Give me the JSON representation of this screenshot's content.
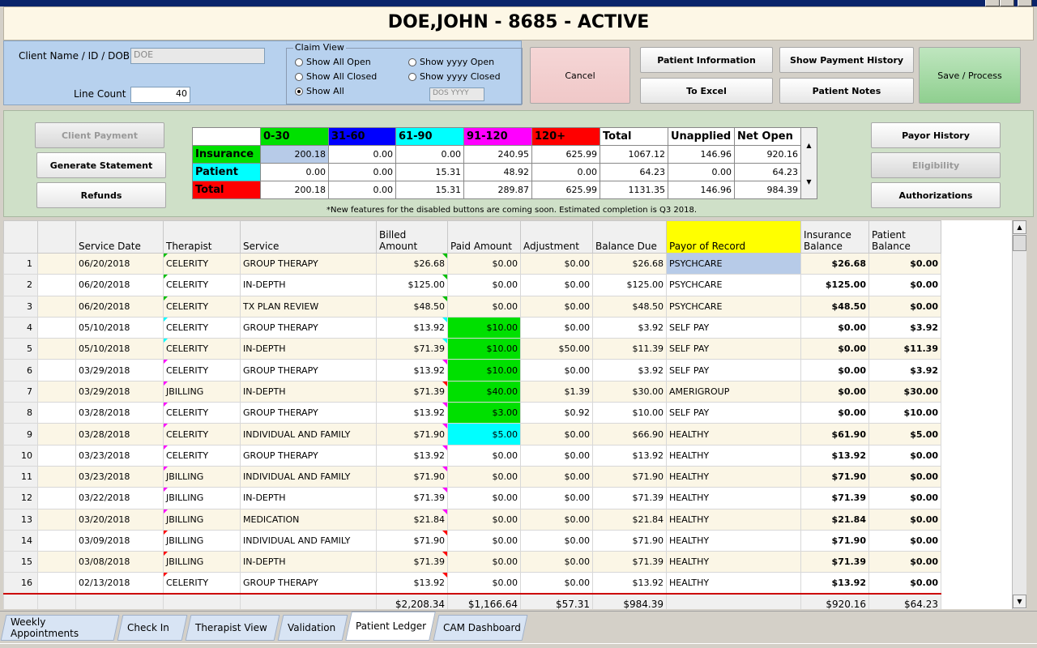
{
  "header": {
    "title": "DOE,JOHN - 8685 - ACTIVE"
  },
  "client": {
    "name_label": "Client Name / ID / DOB",
    "name_value": "DOE",
    "line_count_label": "Line Count",
    "line_count_value": "40"
  },
  "claim_view": {
    "legend": "Claim View",
    "options": [
      "Show All Open",
      "Show All Closed",
      "Show All",
      "Show yyyy Open",
      "Show yyyy Closed"
    ],
    "selected": "Show All",
    "dos_placeholder": "DOS YYYY"
  },
  "buttons": {
    "cancel": "Cancel",
    "patient_information": "Patient Information",
    "show_payment_history": "Show Payment History",
    "to_excel": "To Excel",
    "patient_notes": "Patient Notes",
    "save_process": "Save / Process",
    "client_payment": "Client Payment",
    "generate_statement": "Generate Statement",
    "refunds": "Refunds",
    "payor_history": "Payor History",
    "eligibility": "Eligibility",
    "authorizations": "Authorizations"
  },
  "aging": {
    "headers": [
      "0-30",
      "31-60",
      "61-90",
      "91-120",
      "120+",
      "Total",
      "Unapplied",
      "Net Open"
    ],
    "header_colors": [
      "#00e000",
      "#0000ff",
      "#00ffff",
      "#ff00ff",
      "#ff0000",
      "#ffffff",
      "#ffffff",
      "#ffffff"
    ],
    "rows": [
      {
        "label": "Insurance",
        "color": "#00e000",
        "values": [
          "200.18",
          "0.00",
          "0.00",
          "240.95",
          "625.99",
          "1067.12",
          "146.96",
          "920.16"
        ]
      },
      {
        "label": "Patient",
        "color": "#00ffff",
        "values": [
          "0.00",
          "0.00",
          "15.31",
          "48.92",
          "0.00",
          "64.23",
          "0.00",
          "64.23"
        ]
      },
      {
        "label": "Total",
        "color": "#ff0000",
        "values": [
          "200.18",
          "0.00",
          "15.31",
          "289.87",
          "625.99",
          "1131.35",
          "146.96",
          "984.39"
        ]
      }
    ],
    "note": "*New features for the disabled buttons are coming soon. Estimated completion is Q3 2018."
  },
  "grid": {
    "columns": [
      "",
      "",
      "Service Date",
      "Therapist",
      "Service",
      "Billed Amount",
      "Paid Amount",
      "Adjustment",
      "Balance Due",
      "Payor of Record",
      "Insurance Balance",
      "Patient Balance"
    ],
    "rows": [
      {
        "n": "1",
        "date": "06/20/2018",
        "therapist": "CELERITY",
        "service": "GROUP THERAPY",
        "billed": "$26.68",
        "paid": "$0.00",
        "adj": "$0.00",
        "due": "$26.68",
        "payor": "PSYCHCARE",
        "ins": "$26.68",
        "pat": "$0.00",
        "paid_color": "",
        "tflag": "#00c000",
        "bflag": "#00c000"
      },
      {
        "n": "2",
        "date": "06/20/2018",
        "therapist": "CELERITY",
        "service": "IN-DEPTH",
        "billed": "$125.00",
        "paid": "$0.00",
        "adj": "$0.00",
        "due": "$125.00",
        "payor": "PSYCHCARE",
        "ins": "$125.00",
        "pat": "$0.00",
        "paid_color": "",
        "tflag": "#00c000",
        "bflag": "#00c000"
      },
      {
        "n": "3",
        "date": "06/20/2018",
        "therapist": "CELERITY",
        "service": "TX PLAN REVIEW",
        "billed": "$48.50",
        "paid": "$0.00",
        "adj": "$0.00",
        "due": "$48.50",
        "payor": "PSYCHCARE",
        "ins": "$48.50",
        "pat": "$0.00",
        "paid_color": "",
        "tflag": "#00c000",
        "bflag": "#00c000"
      },
      {
        "n": "4",
        "date": "05/10/2018",
        "therapist": "CELERITY",
        "service": "GROUP THERAPY",
        "billed": "$13.92",
        "paid": "$10.00",
        "adj": "$0.00",
        "due": "$3.92",
        "payor": "SELF PAY",
        "ins": "$0.00",
        "pat": "$3.92",
        "paid_color": "#00e000",
        "tflag": "#00ffff",
        "bflag": "#00ffff"
      },
      {
        "n": "5",
        "date": "05/10/2018",
        "therapist": "CELERITY",
        "service": "IN-DEPTH",
        "billed": "$71.39",
        "paid": "$10.00",
        "adj": "$50.00",
        "due": "$11.39",
        "payor": "SELF PAY",
        "ins": "$0.00",
        "pat": "$11.39",
        "paid_color": "#00e000",
        "tflag": "#00ffff",
        "bflag": "#00ffff"
      },
      {
        "n": "6",
        "date": "03/29/2018",
        "therapist": "CELERITY",
        "service": "GROUP THERAPY",
        "billed": "$13.92",
        "paid": "$10.00",
        "adj": "$0.00",
        "due": "$3.92",
        "payor": "SELF PAY",
        "ins": "$0.00",
        "pat": "$3.92",
        "paid_color": "#00e000",
        "tflag": "#ff00ff",
        "bflag": "#ff00ff"
      },
      {
        "n": "7",
        "date": "03/29/2018",
        "therapist": "JBILLING",
        "service": "IN-DEPTH",
        "billed": "$71.39",
        "paid": "$40.00",
        "adj": "$1.39",
        "due": "$30.00",
        "payor": "AMERIGROUP",
        "ins": "$0.00",
        "pat": "$30.00",
        "paid_color": "#00e000",
        "tflag": "#ff00ff",
        "bflag": "#ff0000"
      },
      {
        "n": "8",
        "date": "03/28/2018",
        "therapist": "CELERITY",
        "service": "GROUP THERAPY",
        "billed": "$13.92",
        "paid": "$3.00",
        "adj": "$0.92",
        "due": "$10.00",
        "payor": "SELF PAY",
        "ins": "$0.00",
        "pat": "$10.00",
        "paid_color": "#00e000",
        "tflag": "#ff00ff",
        "bflag": "#ff00ff"
      },
      {
        "n": "9",
        "date": "03/28/2018",
        "therapist": "CELERITY",
        "service": "INDIVIDUAL AND FAMILY",
        "billed": "$71.90",
        "paid": "$5.00",
        "adj": "$0.00",
        "due": "$66.90",
        "payor": "HEALTHY",
        "ins": "$61.90",
        "pat": "$5.00",
        "paid_color": "#00ffff",
        "tflag": "#ff00ff",
        "bflag": "#ff00ff"
      },
      {
        "n": "10",
        "date": "03/23/2018",
        "therapist": "CELERITY",
        "service": "GROUP THERAPY",
        "billed": "$13.92",
        "paid": "$0.00",
        "adj": "$0.00",
        "due": "$13.92",
        "payor": "HEALTHY",
        "ins": "$13.92",
        "pat": "$0.00",
        "paid_color": "",
        "tflag": "#ff00ff",
        "bflag": "#ff00ff"
      },
      {
        "n": "11",
        "date": "03/23/2018",
        "therapist": "JBILLING",
        "service": "INDIVIDUAL AND FAMILY",
        "billed": "$71.90",
        "paid": "$0.00",
        "adj": "$0.00",
        "due": "$71.90",
        "payor": "HEALTHY",
        "ins": "$71.90",
        "pat": "$0.00",
        "paid_color": "",
        "tflag": "#ff00ff",
        "bflag": "#ff00ff"
      },
      {
        "n": "12",
        "date": "03/22/2018",
        "therapist": "JBILLING",
        "service": "IN-DEPTH",
        "billed": "$71.39",
        "paid": "$0.00",
        "adj": "$0.00",
        "due": "$71.39",
        "payor": "HEALTHY",
        "ins": "$71.39",
        "pat": "$0.00",
        "paid_color": "",
        "tflag": "#ff00ff",
        "bflag": "#ff00ff"
      },
      {
        "n": "13",
        "date": "03/20/2018",
        "therapist": "JBILLING",
        "service": "MEDICATION",
        "billed": "$21.84",
        "paid": "$0.00",
        "adj": "$0.00",
        "due": "$21.84",
        "payor": "HEALTHY",
        "ins": "$21.84",
        "pat": "$0.00",
        "paid_color": "",
        "tflag": "#ff00ff",
        "bflag": "#ff00ff"
      },
      {
        "n": "14",
        "date": "03/09/2018",
        "therapist": "JBILLING",
        "service": "INDIVIDUAL AND FAMILY",
        "billed": "$71.90",
        "paid": "$0.00",
        "adj": "$0.00",
        "due": "$71.90",
        "payor": "HEALTHY",
        "ins": "$71.90",
        "pat": "$0.00",
        "paid_color": "",
        "tflag": "#ff0000",
        "bflag": "#ff0000"
      },
      {
        "n": "15",
        "date": "03/08/2018",
        "therapist": "JBILLING",
        "service": "IN-DEPTH",
        "billed": "$71.39",
        "paid": "$0.00",
        "adj": "$0.00",
        "due": "$71.39",
        "payor": "HEALTHY",
        "ins": "$71.39",
        "pat": "$0.00",
        "paid_color": "",
        "tflag": "#ff0000",
        "bflag": "#ff0000"
      },
      {
        "n": "16",
        "date": "02/13/2018",
        "therapist": "CELERITY",
        "service": "GROUP THERAPY",
        "billed": "$13.92",
        "paid": "$0.00",
        "adj": "$0.00",
        "due": "$13.92",
        "payor": "HEALTHY",
        "ins": "$13.92",
        "pat": "$0.00",
        "paid_color": "",
        "tflag": "#ff0000",
        "bflag": "#ff0000"
      }
    ],
    "totals": {
      "billed": "$2,208.34",
      "paid": "$1,166.64",
      "adj": "$57.31",
      "due": "$984.39",
      "ins": "$920.16",
      "pat": "$64.23"
    },
    "payor_header_color": "#ffff00",
    "selected_payor_color": "#b7cbe8"
  },
  "tabs": [
    {
      "label": "Weekly Appointments",
      "active": false
    },
    {
      "label": "Check In",
      "active": false
    },
    {
      "label": "Therapist View",
      "active": false
    },
    {
      "label": "Validation",
      "active": false
    },
    {
      "label": "Patient Ledger",
      "active": true
    },
    {
      "label": "CAM Dashboard",
      "active": false
    }
  ]
}
